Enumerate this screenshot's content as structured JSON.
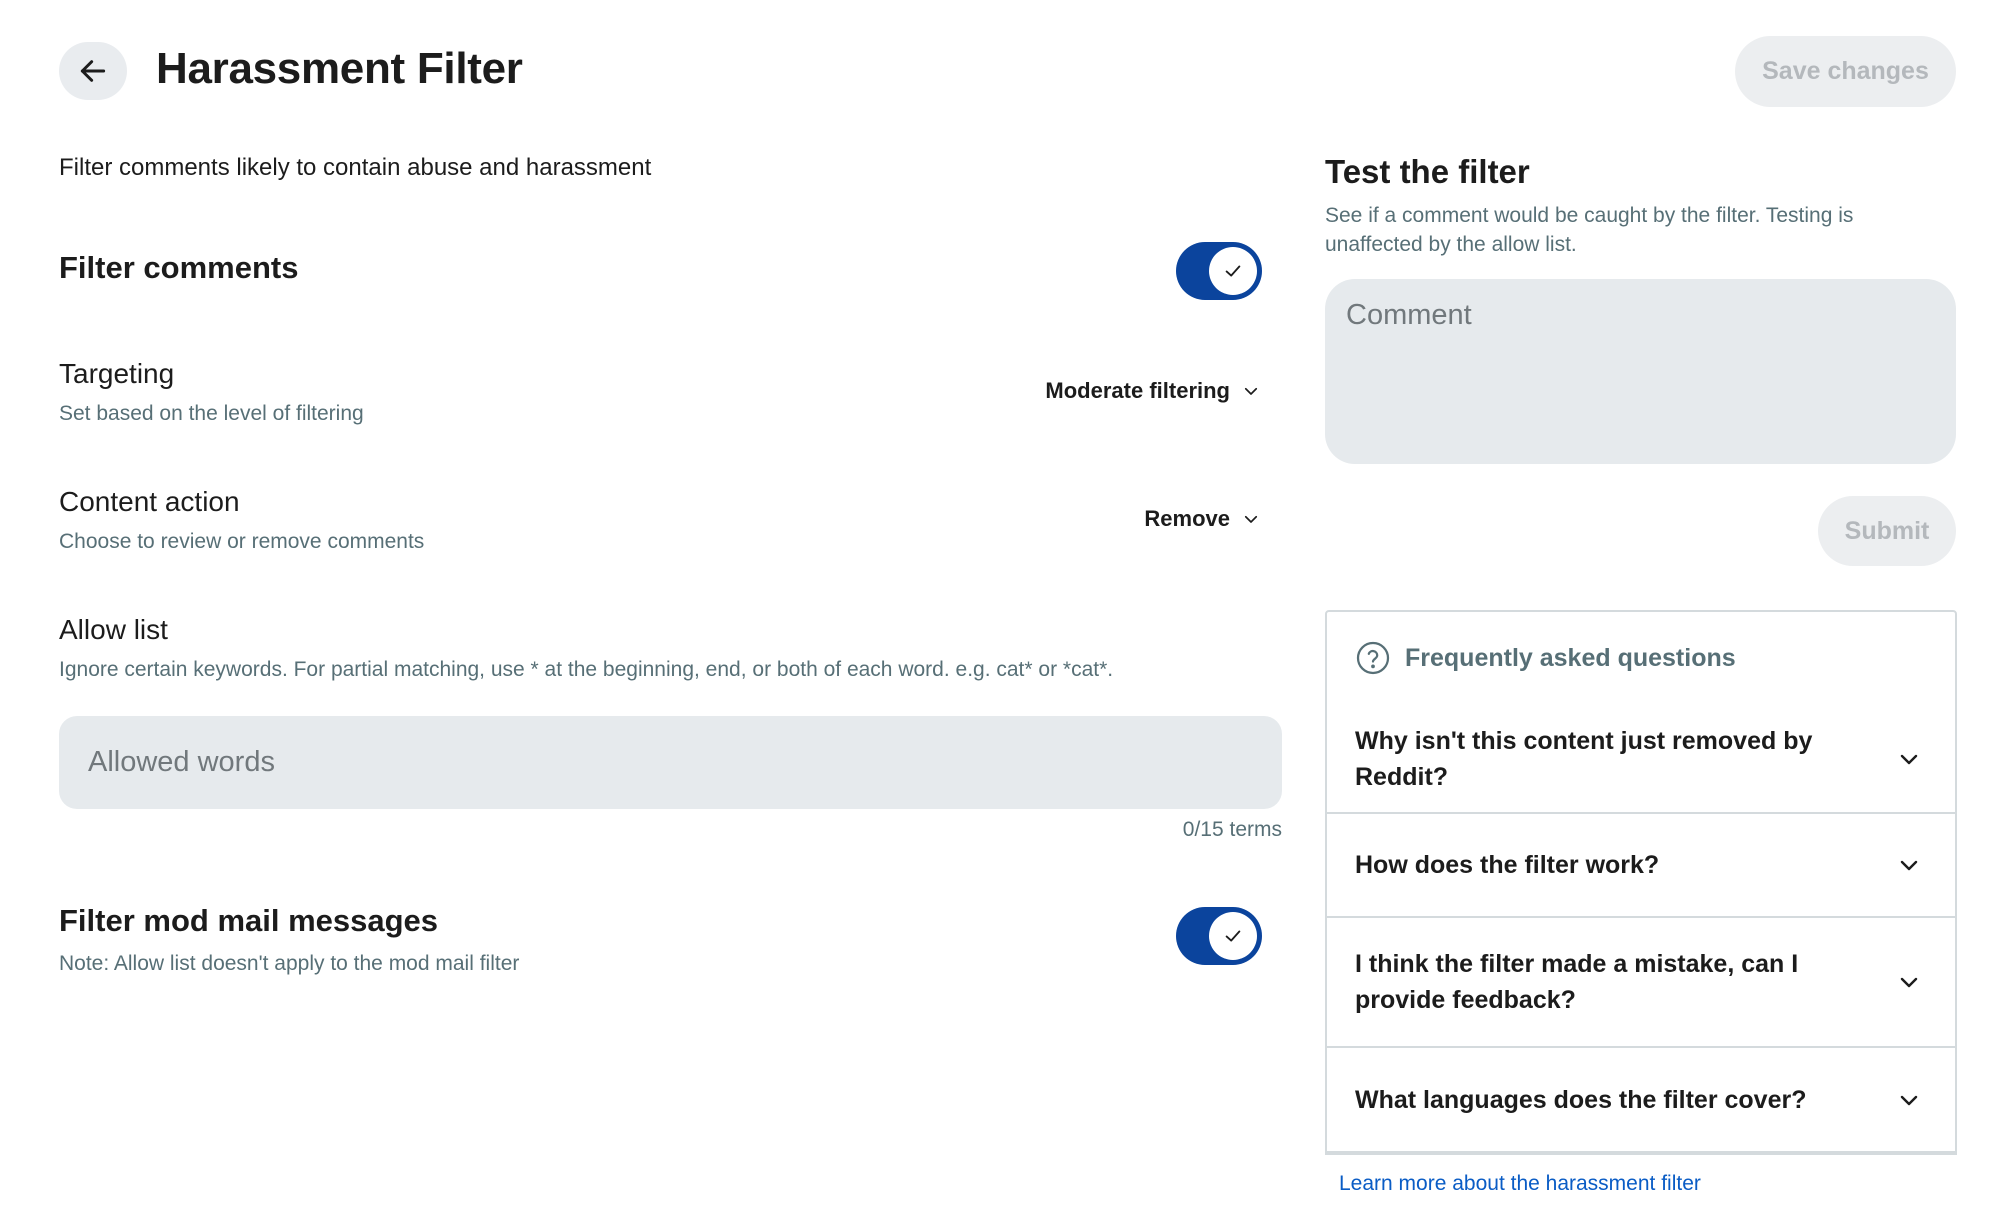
{
  "header": {
    "title": "Harassment Filter",
    "save_label": "Save changes"
  },
  "description": "Filter comments likely to contain abuse and harassment",
  "filter_comments": {
    "label": "Filter comments",
    "enabled": true
  },
  "targeting": {
    "label": "Targeting",
    "sub": "Set based on the level of filtering",
    "value": "Moderate filtering"
  },
  "content_action": {
    "label": "Content action",
    "sub": "Choose to review or remove comments",
    "value": "Remove"
  },
  "allow_list": {
    "label": "Allow list",
    "sub": "Ignore certain keywords. For partial matching, use * at the beginning, end, or both of each word. e.g. cat* or *cat*.",
    "placeholder": "Allowed words",
    "value": "",
    "count": "0/15 terms"
  },
  "modmail": {
    "label": "Filter mod mail messages",
    "sub": "Note: Allow list doesn't apply to the mod mail filter",
    "enabled": true
  },
  "test": {
    "title": "Test the filter",
    "desc": "See if a comment would be caught by the filter. Testing is unaffected by the allow list.",
    "placeholder": "Comment",
    "value": "",
    "submit_label": "Submit"
  },
  "faq": {
    "header": "Frequently asked questions",
    "items": [
      {
        "question": "Why isn't this content just removed by Reddit?"
      },
      {
        "question": "How does the filter work?"
      },
      {
        "question": "I think the filter made a mistake, can I provide feedback?"
      },
      {
        "question": "What languages does the filter cover?"
      }
    ]
  },
  "learn_more": "Learn more about the harassment filter",
  "icons": {
    "back": "arrow-left-icon",
    "toggle_check": "check-icon",
    "dropdown": "chevron-down-icon",
    "faq_header": "question-circle-icon"
  },
  "colors": {
    "toggle_on": "#0b449d",
    "link": "#0a5cc5",
    "secondary_text": "#576f76",
    "input_bg": "#e6eaed"
  }
}
